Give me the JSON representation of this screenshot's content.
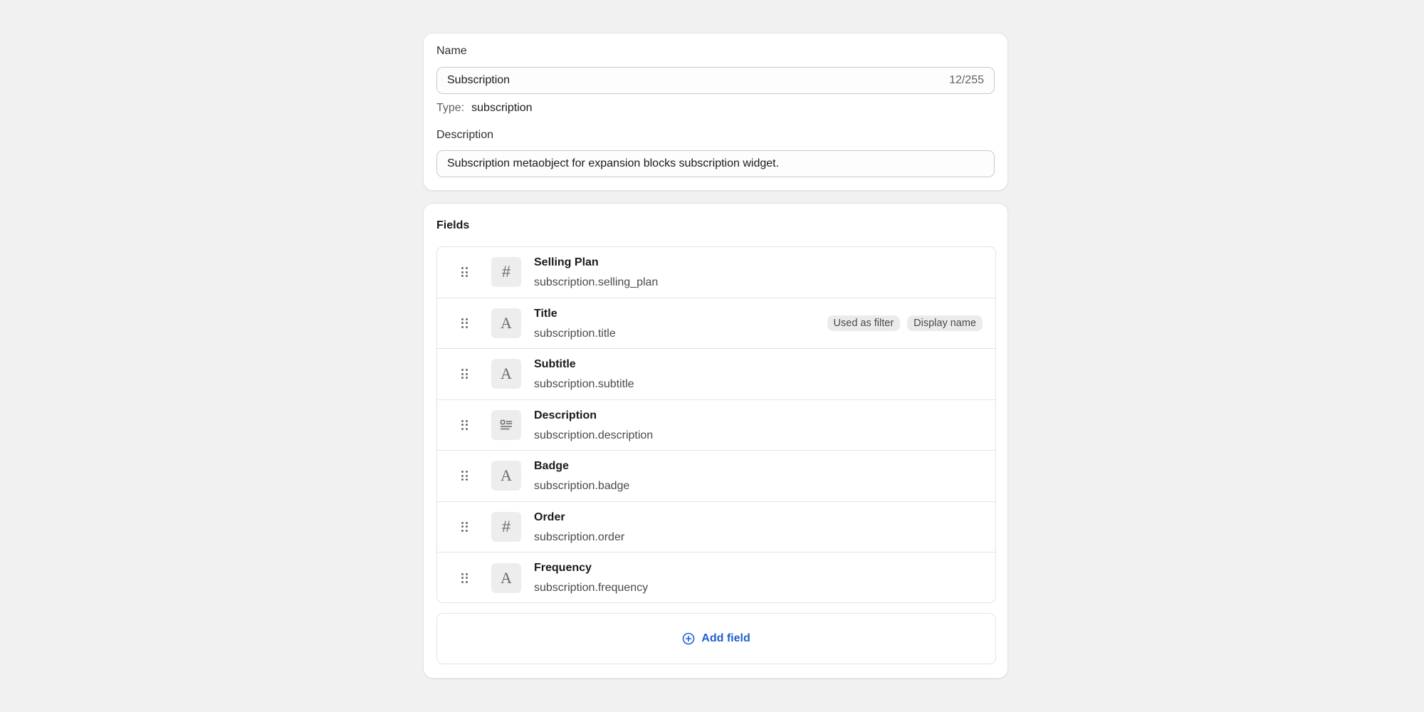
{
  "general": {
    "name_label": "Name",
    "name_value": "Subscription",
    "name_count": "12/255",
    "type_label": "Type:",
    "type_value": "subscription",
    "description_label": "Description",
    "description_value": "Subscription metaobject for expansion blocks subscription widget."
  },
  "fields": {
    "title": "Fields",
    "items": [
      {
        "icon": "hash-icon",
        "glyph": "#",
        "name": "Selling Plan",
        "key": "subscription.selling_plan",
        "badges": []
      },
      {
        "icon": "text-icon",
        "glyph": "A",
        "name": "Title",
        "key": "subscription.title",
        "badges": [
          "Used as filter",
          "Display name"
        ]
      },
      {
        "icon": "text-icon",
        "glyph": "A",
        "name": "Subtitle",
        "key": "subscription.subtitle",
        "badges": []
      },
      {
        "icon": "multiline-text-icon",
        "glyph": "",
        "name": "Description",
        "key": "subscription.description",
        "badges": []
      },
      {
        "icon": "text-icon",
        "glyph": "A",
        "name": "Badge",
        "key": "subscription.badge",
        "badges": []
      },
      {
        "icon": "hash-icon",
        "glyph": "#",
        "name": "Order",
        "key": "subscription.order",
        "badges": []
      },
      {
        "icon": "text-icon",
        "glyph": "A",
        "name": "Frequency",
        "key": "subscription.frequency",
        "badges": []
      }
    ],
    "add_label": "Add field"
  },
  "colors": {
    "accent": "#1f5fd1",
    "background": "#f1f1f1"
  }
}
